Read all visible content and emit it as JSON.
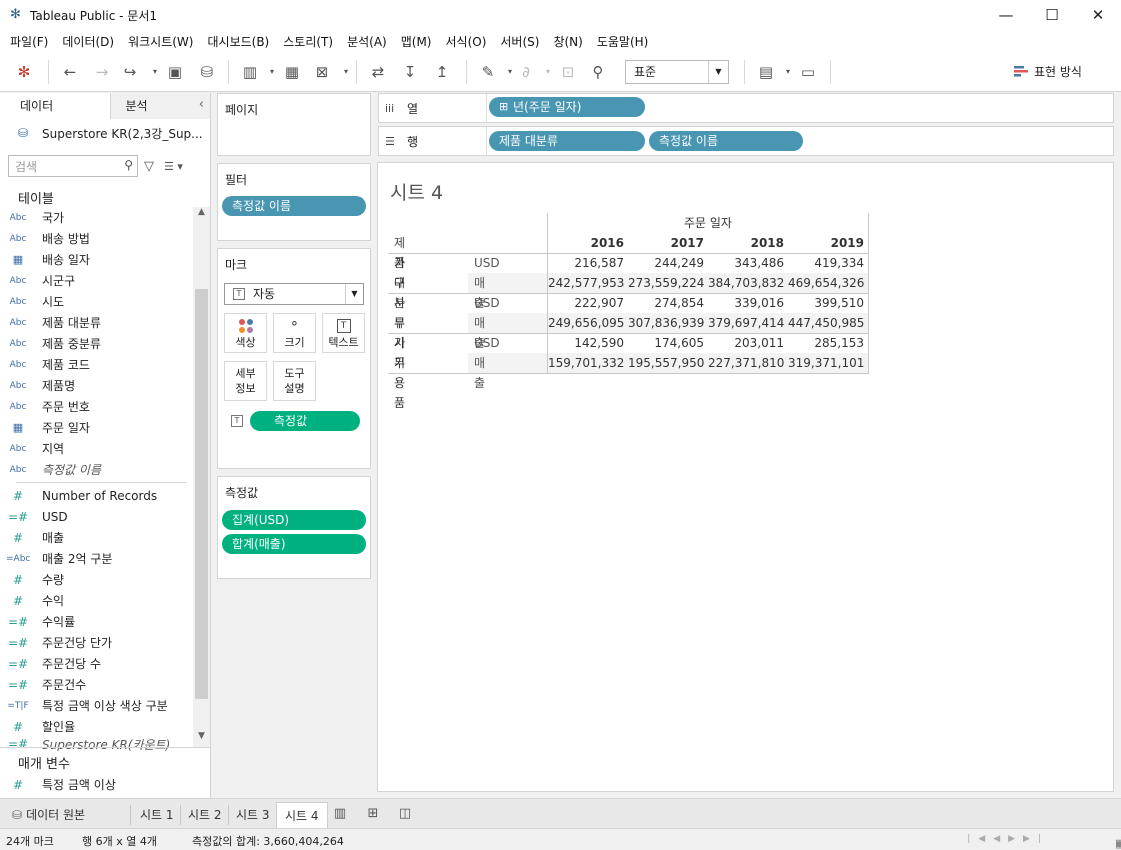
{
  "window": {
    "title": "Tableau Public - 문서1",
    "minimize": "—",
    "maximize": "☐",
    "close": "✕"
  },
  "menu": [
    "파일(F)",
    "데이터(D)",
    "워크시트(W)",
    "대시보드(B)",
    "스토리(T)",
    "분석(A)",
    "맵(M)",
    "서식(O)",
    "서버(S)",
    "창(N)",
    "도움말(H)"
  ],
  "toolbar": {
    "fit_select": "표준",
    "show_me_label": "표현 방식"
  },
  "datapane": {
    "tab_data": "데이터",
    "tab_analysis": "분석",
    "datasource": "Superstore KR(2,3강_Sup...",
    "search_placeholder": "검색",
    "tables_title": "테이블",
    "parameters_title": "매개 변수",
    "dimensions": [
      {
        "icon": "Abc",
        "label": "국가"
      },
      {
        "icon": "Abc",
        "label": "배송 방법"
      },
      {
        "icon": "cal",
        "label": "배송 일자"
      },
      {
        "icon": "Abc",
        "label": "시군구"
      },
      {
        "icon": "Abc",
        "label": "시도"
      },
      {
        "icon": "Abc",
        "label": "제품 대분류"
      },
      {
        "icon": "Abc",
        "label": "제품 중분류"
      },
      {
        "icon": "Abc",
        "label": "제품 코드"
      },
      {
        "icon": "Abc",
        "label": "제품명"
      },
      {
        "icon": "Abc",
        "label": "주문 번호"
      },
      {
        "icon": "cal",
        "label": "주문 일자"
      },
      {
        "icon": "Abc",
        "label": "지역"
      },
      {
        "icon": "Abc",
        "label": "측정값 이름",
        "italic": true
      }
    ],
    "measures": [
      {
        "icon": "#",
        "label": "Number of Records"
      },
      {
        "icon": "=#",
        "label": "USD"
      },
      {
        "icon": "#",
        "label": "매출"
      },
      {
        "icon": "=Abc",
        "label": "매출 2억 구분"
      },
      {
        "icon": "#",
        "label": "수량"
      },
      {
        "icon": "#",
        "label": "수익"
      },
      {
        "icon": "=#",
        "label": "수익률"
      },
      {
        "icon": "=#",
        "label": "주문건당 단가"
      },
      {
        "icon": "=#",
        "label": "주문건당 수"
      },
      {
        "icon": "=#",
        "label": "주문건수"
      },
      {
        "icon": "=T|F",
        "label": "특정 금액 이상 색상 구분"
      },
      {
        "icon": "#",
        "label": "할인율"
      },
      {
        "icon": "=#",
        "label": "Superstore KR(카운트)",
        "italic": true
      }
    ],
    "parameters": [
      {
        "icon": "#",
        "label": "특정 금액 이상"
      }
    ]
  },
  "cards": {
    "pages_title": "페이지",
    "filters_title": "필터",
    "filter_pill": "측정값 이름",
    "marks_title": "마크",
    "mark_type": "자동",
    "mark_buttons": {
      "color": "색상",
      "size": "크기",
      "text": "텍스트",
      "detail_line1": "세부",
      "detail_line2": "정보",
      "tooltip_line1": "도구",
      "tooltip_line2": "설명"
    },
    "marks_pill": "측정값",
    "measure_values_title": "측정값",
    "measure_pills": [
      "집계(USD)",
      "합계(매출)"
    ]
  },
  "shelves": {
    "columns_label": "열",
    "rows_label": "행",
    "columns_pills": [
      "년(주문 일자)"
    ],
    "rows_pills": [
      "제품 대분류",
      "측정값 이름"
    ]
  },
  "view": {
    "sheet_title": "시트 4",
    "col_header_group": "주문 일자",
    "row_header_field": "제품 대분류",
    "years": [
      "2016",
      "2017",
      "2018",
      "2019"
    ],
    "rows": [
      {
        "category": "가구",
        "measure": "USD",
        "values": [
          "216,587",
          "244,249",
          "343,486",
          "419,334"
        ]
      },
      {
        "category": "",
        "measure": "매출",
        "values": [
          "242,577,953",
          "273,559,224",
          "384,703,832",
          "469,654,326"
        ]
      },
      {
        "category": "사무기기",
        "measure": "USD",
        "values": [
          "222,907",
          "274,854",
          "339,016",
          "399,510"
        ]
      },
      {
        "category": "",
        "measure": "매출",
        "values": [
          "249,656,095",
          "307,836,939",
          "379,697,414",
          "447,450,985"
        ]
      },
      {
        "category": "사무용품",
        "measure": "USD",
        "values": [
          "142,590",
          "174,605",
          "203,011",
          "285,153"
        ]
      },
      {
        "category": "",
        "measure": "매출",
        "values": [
          "159,701,332",
          "195,557,950",
          "227,371,810",
          "319,371,101"
        ]
      }
    ]
  },
  "tabs": {
    "datasource_tab": "데이터 원본",
    "sheets": [
      "시트 1",
      "시트 2",
      "시트 3",
      "시트 4"
    ],
    "active": "시트 4"
  },
  "status": {
    "marks": "24개 마크",
    "rows_by_cols": "행 6개  x  열 4개",
    "sum": "측정값의 합계: 3,660,404,264"
  }
}
